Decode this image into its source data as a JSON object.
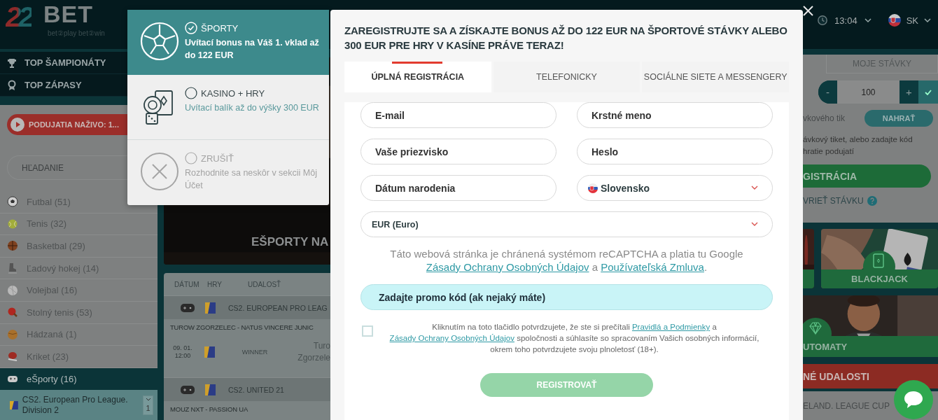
{
  "header": {
    "logo": {
      "mark": "22",
      "word": "BET",
      "tagline": "bet②play bet②win"
    },
    "time": "13:04",
    "language": "SK"
  },
  "sidebar": {
    "top_links": [
      {
        "label": "TOP ŠAMPIONÁTY"
      },
      {
        "label": "TOP ZÁPASY"
      }
    ],
    "live_button": "PODUJATIA NAŽIVO: 1...",
    "search": {
      "placeholder": "HĽADANIE"
    },
    "sports": [
      {
        "name": "Futbal (51)",
        "selected": false
      },
      {
        "name": "Tenis (32)",
        "selected": false
      },
      {
        "name": "Basketbal (29)",
        "selected": false
      },
      {
        "name": "Ľadový hokej (14)",
        "selected": false
      },
      {
        "name": "Volejbal (16)",
        "selected": false
      },
      {
        "name": "Stolný tenis (53)",
        "selected": false
      },
      {
        "name": "Hádzaná (1)",
        "selected": false
      },
      {
        "name": "Kriket (23)",
        "selected": false
      },
      {
        "name": "eŠporty (16)",
        "selected": true
      }
    ],
    "league": {
      "name": "CS2. European Pro League. Division 2",
      "count": "1"
    }
  },
  "main": {
    "banner_title": "EŠPORTY NA",
    "table": {
      "columns": [
        "DÁTUM",
        "HRY",
        "UDALOSŤ"
      ],
      "groups": [
        {
          "league": "CS2. EUROPEAN PRO LEAG",
          "match": "TUROW ZGORZELEC - NATUS VINCERE JUNIC",
          "rows": [
            {
              "date": "09. 01.",
              "time": "12:00",
              "market": "WINNER",
              "team_1": "Turo",
              "team_2": "Zgorzele"
            }
          ]
        },
        {
          "league": "CS2. UNITED 21",
          "match": "MOUZ NXT - PASSION UA"
        }
      ]
    }
  },
  "betslip": {
    "tab": "MOJE STÁVKY",
    "stake": {
      "minus": "-",
      "value": "100",
      "plus": "+"
    },
    "upload_label": "vkového tik",
    "upload_button": "NAHRAŤ",
    "hint_lines": [
      "ávkový tiket, alebo zadajte kód",
      "hratie podujatí"
    ],
    "register_button": "GISTRÁCIA",
    "check_link": "VRIEŤ STÁVKU"
  },
  "casino_tiles": [
    {
      "label": "BLACKJACK"
    },
    {
      "label": "UTOMATY"
    }
  ],
  "events_bar": "NÉ UDALOSTI",
  "event_row": "ELAND. LEAGUE CUP",
  "bonus_panel": {
    "options": [
      {
        "kind": "sports",
        "title": "ŠPORTY",
        "description": "Uvítací bonus na Váš 1. vklad až do 122 EUR",
        "selected": true
      },
      {
        "kind": "casino",
        "title": "KASINO + HRY",
        "description": "Uvítací balík až do výšky 300 EUR",
        "selected": false
      },
      {
        "kind": "cancel",
        "title": "ZRUŠIŤ",
        "description": "Rozhodnite sa neskôr v sekcii Môj Účet",
        "selected": false
      }
    ]
  },
  "modal": {
    "title": "ZAREGISTRUJTE SA A ZÍSKAJTE BONUS AŽ DO 122 EUR NA ŠPORTOVÉ STÁVKY ALEBO 300 EUR PRE HRY V KASÍNE PRÁVE TERAZ!",
    "tabs": [
      {
        "label": "ÚPLNÁ REGISTRÁCIA",
        "selected": true
      },
      {
        "label": "TELEFONICKY",
        "selected": false
      },
      {
        "label": "SOCIÁLNE SIETE A MESSENGERY",
        "selected": false
      }
    ],
    "fields": [
      {
        "kind": "text",
        "placeholder": "E-mail"
      },
      {
        "kind": "text",
        "placeholder": "Krstné meno"
      },
      {
        "kind": "text",
        "placeholder": "Vaše priezvisko"
      },
      {
        "kind": "password",
        "placeholder": "Heslo"
      },
      {
        "kind": "text",
        "placeholder": "Dátum narodenia"
      },
      {
        "kind": "country",
        "value": "Slovensko"
      },
      {
        "kind": "currency",
        "value": "EUR (Euro)"
      }
    ],
    "recaptcha_note": [
      {
        "text": "Táto webová stránka je chránená systémom reCAPTCHA a platia tu Google "
      },
      {
        "link": "Zásady Ochrany Osobných Údajov"
      },
      {
        "text": " a "
      },
      {
        "link": "Používateľská Zmluva"
      },
      {
        "text": "."
      }
    ],
    "promo_toggle": "Zadajte promo kód (ak nejaký máte)",
    "consent": {
      "checked": false,
      "parts": [
        {
          "text": "Kliknutím na toto tlačidlo potvrdzujete, že ste si prečítali "
        },
        {
          "link": "Pravidlá a Podmienky"
        },
        {
          "text": " a "
        },
        {
          "link": "Zásady Ochrany Osobných Údajov"
        },
        {
          "text": " spoločnosti a súhlasíte so spracovaním Vašich osobných informácií, okrem toho potvrdzujete svoju plnoletosť (18+)."
        }
      ]
    },
    "submit": {
      "label": "REGISTROVAŤ",
      "disabled": true
    }
  }
}
